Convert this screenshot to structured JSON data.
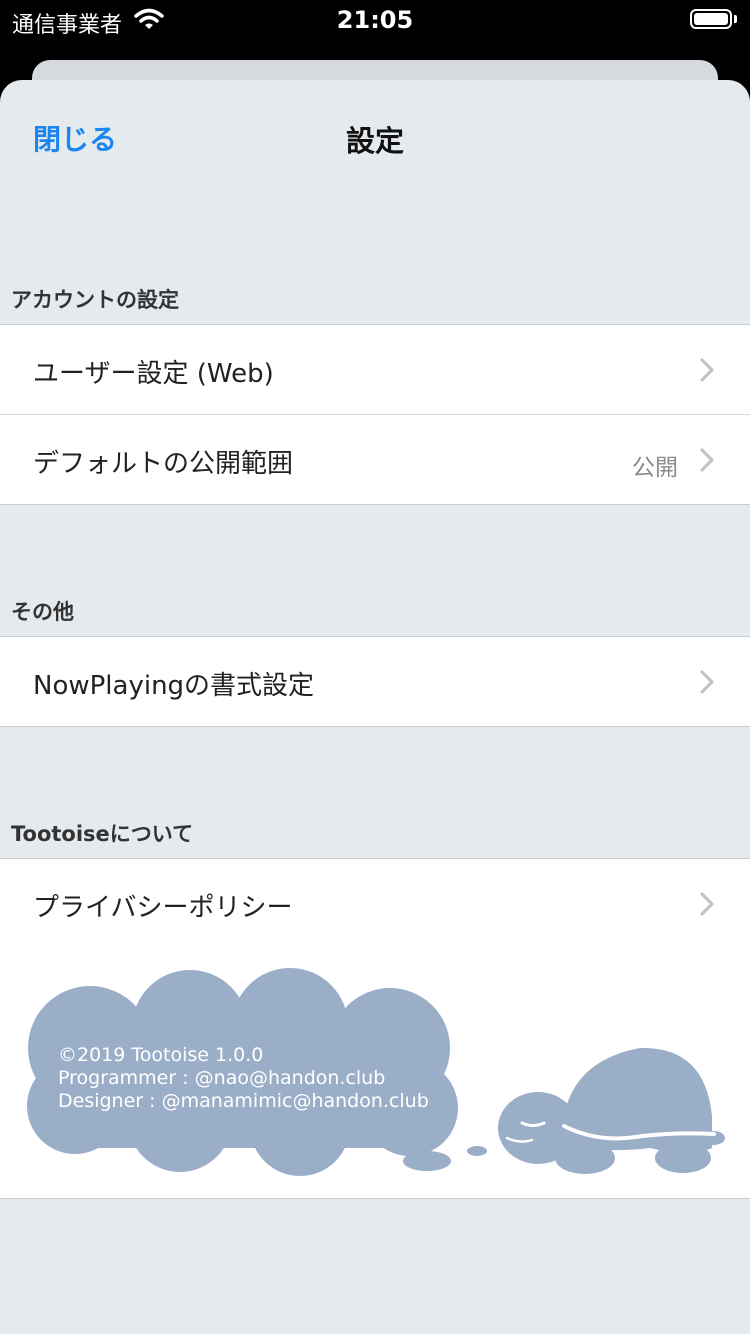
{
  "status_bar": {
    "carrier": "通信事業者",
    "time": "21:05"
  },
  "nav": {
    "close_label": "閉じる",
    "title": "設定"
  },
  "sections": [
    {
      "header": "アカウントの設定",
      "rows": [
        {
          "label": "ユーザー設定 (Web)",
          "value": ""
        },
        {
          "label": "デフォルトの公開範囲",
          "value": "公開"
        }
      ]
    },
    {
      "header": "その他",
      "rows": [
        {
          "label": "NowPlayingの書式設定",
          "value": ""
        }
      ]
    },
    {
      "header": "Tootoiseについて",
      "rows": [
        {
          "label": "プライバシーポリシー",
          "value": ""
        }
      ]
    }
  ],
  "footer": {
    "credits": [
      "©2019 Tootoise 1.0.0",
      "Programmer : @nao@handon.club",
      "Designer : @manamimic@handon.club"
    ]
  },
  "colors": {
    "accent": "#1b86f0",
    "sheet_background": "#e5eaee",
    "illustration": "#9aaec8"
  },
  "icons": [
    "wifi-icon",
    "battery-icon",
    "chevron-right-icon",
    "turtle-illustration"
  ]
}
